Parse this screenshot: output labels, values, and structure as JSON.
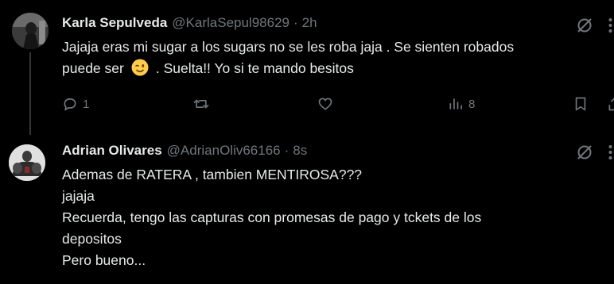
{
  "posts": [
    {
      "author": "Karla Sepulveda",
      "handle": "@KarlaSepul98629",
      "separator": "·",
      "time": "2h",
      "text_lines": [
        "Jajaja eras mi sugar a los sugars no se les roba jaja . Se sienten robados",
        "puede ser",
        ". Suelta!! Yo si te mando besitos"
      ],
      "emoji": "winking-face",
      "actions": {
        "replies": "1",
        "reposts": "",
        "likes": "",
        "views": "8"
      }
    },
    {
      "author": "Adrian Olivares",
      "handle": "@AdrianOliv66166",
      "separator": "·",
      "time": "8s",
      "text_lines": [
        "Ademas de RATERA , tambien MENTIROSA???",
        "jajaja",
        "Recuerda, tengo las capturas con promesas de pago y tckets de los",
        "depositos",
        "Pero bueno..."
      ]
    }
  ],
  "colors": {
    "background": "#000000",
    "primary_text": "#e7e9ea",
    "secondary_text": "#71767b",
    "thread_line": "#333639"
  }
}
